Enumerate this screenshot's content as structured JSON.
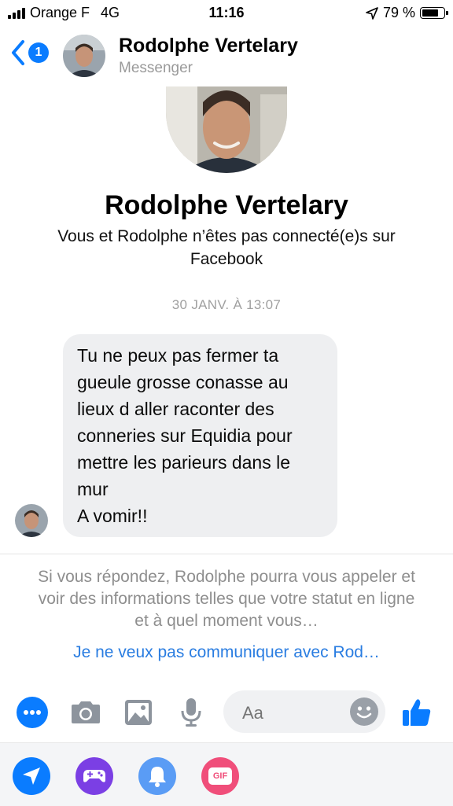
{
  "status_bar": {
    "carrier": "Orange F",
    "network": "4G",
    "time": "11:16",
    "battery": "79 %",
    "battery_level": 0.79
  },
  "header": {
    "back_badge_count": "1",
    "contact_name": "Rodolphe Vertelary",
    "subtitle": "Messenger"
  },
  "profile": {
    "name": "Rodolphe Vertelary",
    "connection_note": "Vous et Rodolphe n’êtes pas connecté(e)s sur Facebook"
  },
  "conversation": {
    "timestamp": "30 JANV. À 13:07",
    "messages": [
      {
        "text": "Tu ne peux pas fermer ta gueule grosse conasse au lieux d aller raconter des conneries sur Equidia pour mettre les parieurs dans le mur\nA vomir!!"
      }
    ]
  },
  "request_notice": {
    "text": "Si vous répondez, Rodolphe pourra vous appeler et voir des informations telles que votre statut en ligne et à quel moment vous…",
    "ignore_link": "Je ne veux pas communiquer avec Rod…"
  },
  "composer": {
    "placeholder": "Aa",
    "icons": [
      "more-icon",
      "camera-icon",
      "gallery-icon",
      "microphone-icon",
      "emoji-icon",
      "thumbs-up-icon"
    ]
  },
  "tray": {
    "icons": [
      "location-icon",
      "game-controller-icon",
      "bell-icon",
      "gif-icon"
    ],
    "gif_label": "GIF"
  },
  "colors": {
    "messenger_blue": "#0a7cff",
    "bubble_gray": "#eeeff1",
    "link_blue": "#2a7de1",
    "game_purple": "#7b3fe4",
    "bell_blue": "#5a9cf5",
    "gif_pink": "#f04e7a"
  }
}
